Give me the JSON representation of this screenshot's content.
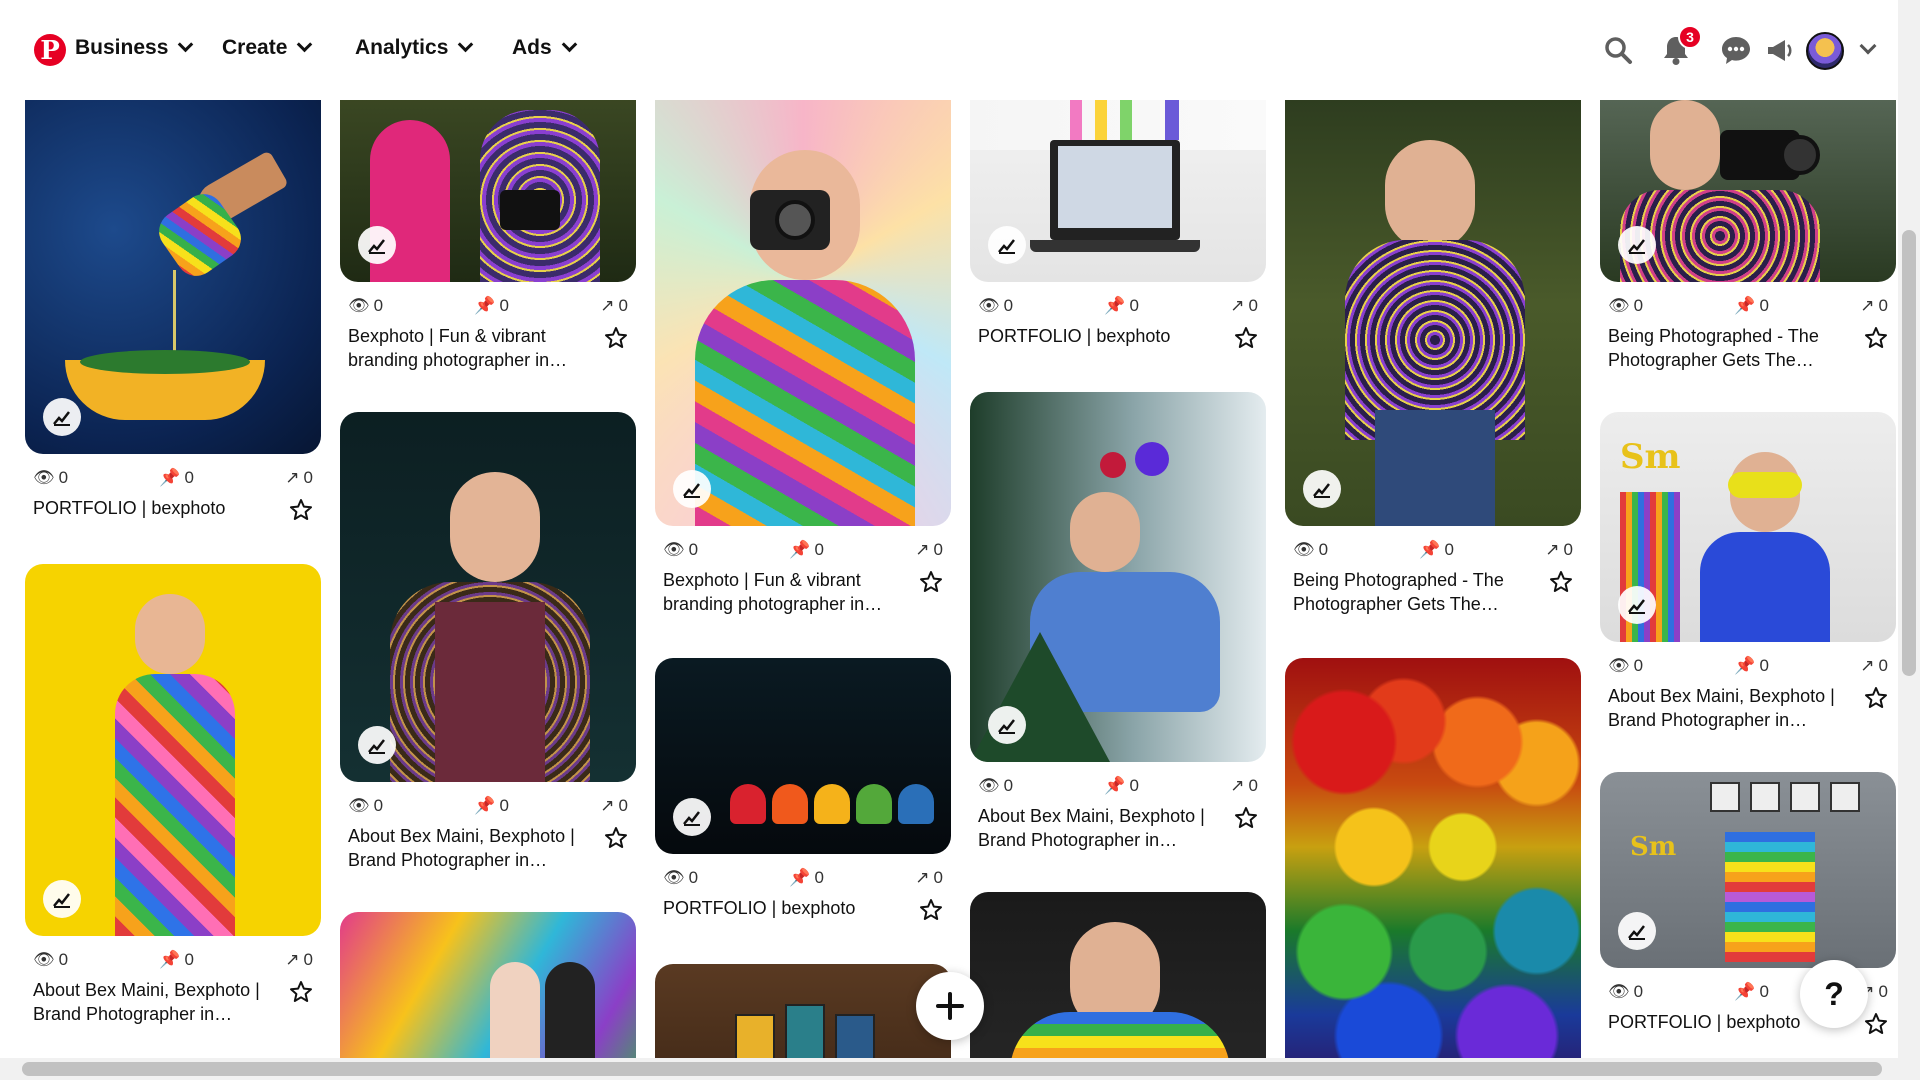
{
  "header": {
    "logo_letter": "P",
    "nav": [
      {
        "label": "Business"
      },
      {
        "label": "Create"
      },
      {
        "label": "Analytics"
      },
      {
        "label": "Ads"
      }
    ],
    "notification_count": "3"
  },
  "pins": [
    {
      "title": "PORTFOLIO | bexphoto",
      "impressions": "0",
      "saves": "0",
      "clicks": "0",
      "image": "olive-oil-bottle-blue-background"
    },
    {
      "title": "About Bex Maini, Bexphoto | Brand Photographer in Sussex",
      "impressions": "0",
      "saves": "0",
      "clicks": "0",
      "image": "woman-rainbow-dress-yellow-wall"
    },
    {
      "title": "",
      "impressions": "",
      "saves": "",
      "clicks": "",
      "image": "two-women-graffiti-wall"
    },
    {
      "title": "Bexphoto | Fun & vibrant branding photographer in Sussex",
      "impressions": "0",
      "saves": "0",
      "clicks": "0",
      "image": "two-women-with-camera"
    },
    {
      "title": "About Bex Maini, Bexphoto | Brand Photographer in Sussex",
      "impressions": "0",
      "saves": "0",
      "clicks": "0",
      "image": "woman-sequin-jacket-dark-background"
    },
    {
      "title": "Bexphoto | Fun & vibrant branding photographer in Sussex",
      "impressions": "0",
      "saves": "0",
      "clicks": "0",
      "image": "woman-camera-kaleidoscope"
    },
    {
      "title": "PORTFOLIO | bexphoto",
      "impressions": "0",
      "saves": "0",
      "clicks": "0",
      "image": "colourful-jelly-sweets"
    },
    {
      "title": "",
      "impressions": "",
      "saves": "",
      "clicks": "",
      "image": "tarot-cards-on-wood"
    },
    {
      "title": "PORTFOLIO | bexphoto",
      "impressions": "0",
      "saves": "0",
      "clicks": "0",
      "image": "laptop-on-desk-with-vases"
    },
    {
      "title": "About Bex Maini, Bexphoto | Brand Photographer in Sussex",
      "impressions": "0",
      "saves": "0",
      "clicks": "0",
      "image": "woman-by-window-christmas-tree"
    },
    {
      "title": "",
      "impressions": "",
      "saves": "",
      "clicks": "",
      "image": "woman-rainbow-jumper"
    },
    {
      "title": "Being Photographed - The Photographer Gets The Brand Shoot Treatment",
      "impressions": "0",
      "saves": "0",
      "clicks": "0",
      "image": "woman-laughing-garden"
    },
    {
      "title": "",
      "impressions": "",
      "saves": "",
      "clicks": "",
      "image": "rainbow-christmas-baubles"
    },
    {
      "title": "Being Photographed - The Photographer Gets The Brand Shoot Treatment",
      "impressions": "0",
      "saves": "0",
      "clicks": "0",
      "image": "woman-holding-camera-outdoors"
    },
    {
      "title": "About Bex Maini, Bexphoto | Brand Photographer in Sussex",
      "impressions": "0",
      "saves": "0",
      "clicks": "0",
      "image": "woman-smile-sign-glasses"
    },
    {
      "title": "PORTFOLIO | bexphoto",
      "impressions": "0",
      "saves": "0",
      "clicks": "0",
      "image": "smile-sign-paint-swatches"
    }
  ],
  "help_label": "?"
}
